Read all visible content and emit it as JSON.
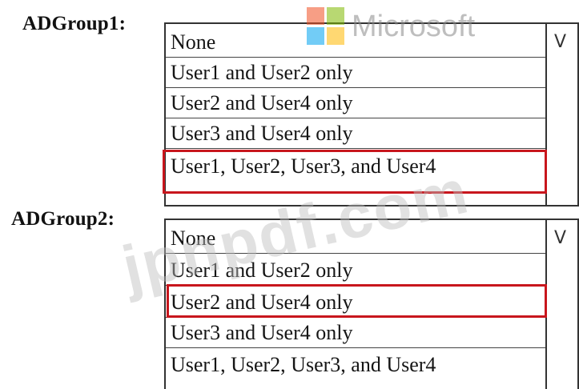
{
  "groups": [
    {
      "label": "ADGroup1:",
      "options": [
        "None",
        "User1 and User2 only",
        "User2 and User4 only",
        "User3 and User4 only",
        "User1, User2, User3, and User4"
      ],
      "selected_index": 4,
      "chevron": "V"
    },
    {
      "label": "ADGroup2:",
      "options": [
        "None",
        "User1 and User2 only",
        "User2 and User4 only",
        "User3 and User4 only",
        "User1, User2, User3, and User4"
      ],
      "selected_index": 2,
      "chevron": "V"
    }
  ],
  "watermarks": {
    "brand": "Microsoft",
    "site": "jpnpdf.com"
  },
  "colors": {
    "highlight": "#c8161d",
    "ms_red": "#f25022",
    "ms_green": "#7fba00",
    "ms_blue": "#00a4ef",
    "ms_yellow": "#ffb900"
  }
}
